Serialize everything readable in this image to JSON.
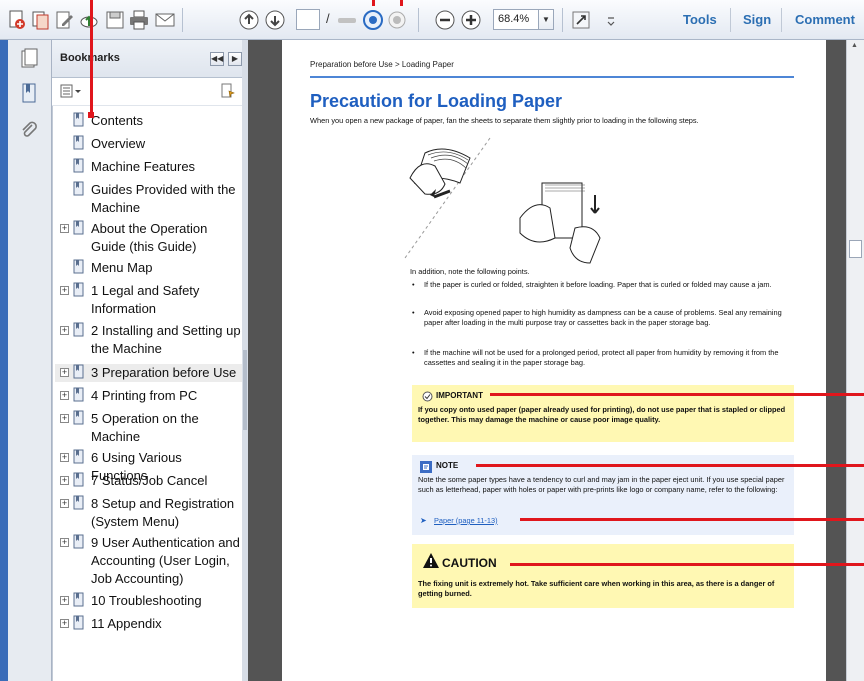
{
  "toolbar": {
    "page_current": "",
    "page_separator": "/",
    "zoom": "68.4%",
    "tools_label": "Tools",
    "sign_label": "Sign",
    "comment_label": "Comment"
  },
  "bookmarks": {
    "title": "Bookmarks",
    "items": [
      {
        "label": "Contents",
        "expandable": false
      },
      {
        "label": "Overview",
        "expandable": false
      },
      {
        "label": "Machine Features",
        "expandable": false
      },
      {
        "label": "Guides Provided with the Machine",
        "expandable": false
      },
      {
        "label": "About the Operation Guide (this Guide)",
        "expandable": true
      },
      {
        "label": "Menu Map",
        "expandable": false
      },
      {
        "label": "1 Legal and Safety Information",
        "expandable": true
      },
      {
        "label": "2 Installing and Setting up the Machine",
        "expandable": true
      },
      {
        "label": "3 Preparation before Use",
        "expandable": true,
        "selected": true
      },
      {
        "label": "4 Printing from PC",
        "expandable": true
      },
      {
        "label": "5 Operation on the Machine",
        "expandable": true
      },
      {
        "label": "6 Using Various Functions",
        "expandable": true
      },
      {
        "label": "7 Status/Job Cancel",
        "expandable": true
      },
      {
        "label": "8 Setup and Registration (System Menu)",
        "expandable": true
      },
      {
        "label": "9 User Authentication and Accounting (User Login, Job Accounting)",
        "expandable": true
      },
      {
        "label": "10 Troubleshooting",
        "expandable": true
      },
      {
        "label": "11 Appendix",
        "expandable": true
      }
    ]
  },
  "document": {
    "breadcrumb": "Preparation before Use > Loading Paper",
    "title": "Precaution for Loading Paper",
    "intro": "When you open a new package of paper, fan the sheets to separate them slightly prior to loading in the following steps.",
    "additional_note": "In addition, note the following points.",
    "bullets": [
      "If the paper is curled or folded, straighten it before loading. Paper that is curled or folded may cause a jam.",
      "Avoid exposing opened paper to high humidity as dampness can be a cause of problems. Seal any remaining paper after loading in the multi purpose tray or cassettes back in the paper storage bag.",
      "If the machine will not be used for a prolonged period, protect all paper from humidity by removing it from the cassettes and sealing it in the paper storage bag."
    ],
    "important": {
      "heading": "IMPORTANT",
      "text": "If you copy onto used paper (paper already used for printing), do not use paper that is stapled or clipped together. This may damage the machine or cause poor image quality."
    },
    "note": {
      "heading": "NOTE",
      "text": "Note the some paper types have a tendency to curl and may jam in the paper eject unit. If you use special paper such as letterhead, paper with holes or paper with pre-prints like logo or company name, refer to the following:",
      "link": "Paper (page 11-13)"
    },
    "caution": {
      "heading": "CAUTION",
      "text": "The fixing unit is extremely hot. Take sufficient care when working in this area, as there is a danger of getting burned."
    }
  },
  "colors": {
    "accent": "#1f5fc0",
    "callout": "#e0161c",
    "important_bg": "#fff8b3",
    "note_bg": "#eaf0fb"
  }
}
